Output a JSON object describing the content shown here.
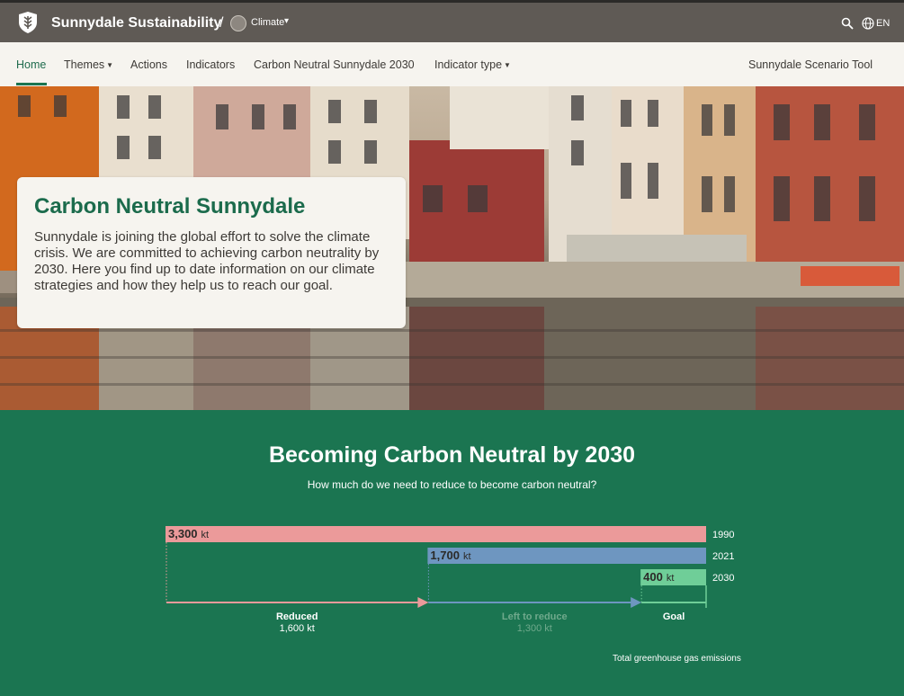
{
  "header": {
    "site_title": "Sunnydale Sustainability",
    "separator": "/",
    "plan_name": "Climate",
    "language": "EN",
    "logo_icon": "leaf-shield-icon",
    "search_icon": "search-icon",
    "globe_icon": "globe-icon"
  },
  "nav": {
    "items": [
      {
        "label": "Home",
        "active": true
      },
      {
        "label": "Themes",
        "dropdown": true
      },
      {
        "label": "Actions"
      },
      {
        "label": "Indicators"
      },
      {
        "label": "Carbon Neutral Sunnydale 2030"
      },
      {
        "label": "Indicator type",
        "dropdown": true
      }
    ],
    "right_item": "Sunnydale Scenario Tool"
  },
  "hero": {
    "title": "Carbon Neutral Sunnydale",
    "text": "Sunnydale is joining the global effort to solve the climate crisis. We are committed to achieving carbon neutrality by 2030. Here you find up to date information on our climate strategies and how they help us to reach our goal."
  },
  "section": {
    "title": "Becoming Carbon Neutral by 2030",
    "subtitle": "How much do we need to reduce to become carbon neutral?",
    "caption": "Total greenhouse gas emissions"
  },
  "chart_data": {
    "type": "bar",
    "unit": "kt",
    "max": 3300,
    "bars": [
      {
        "year": "1990",
        "value": 3300,
        "label": "3,300",
        "color": "#eb9a9a"
      },
      {
        "year": "2021",
        "value": 1700,
        "label": "1,700",
        "color": "#6e96c0"
      },
      {
        "year": "2030",
        "value": 400,
        "label": "400",
        "color": "#6fce98"
      }
    ],
    "segments": [
      {
        "label": "Reduced",
        "value": "1,600 kt",
        "color": "#eb9a9a",
        "text_color": "#ffffff"
      },
      {
        "label": "Left to reduce",
        "value": "1,300 kt",
        "color": "#6e96c0",
        "text_color": "#6fa98c"
      },
      {
        "label": "Goal",
        "value": "",
        "color": "#6fce98",
        "text_color": "#ffffff"
      }
    ]
  },
  "colors": {
    "topbar": "#5f5a55",
    "nav_bg": "#f6f4ef",
    "brand_green": "#1b7551"
  }
}
